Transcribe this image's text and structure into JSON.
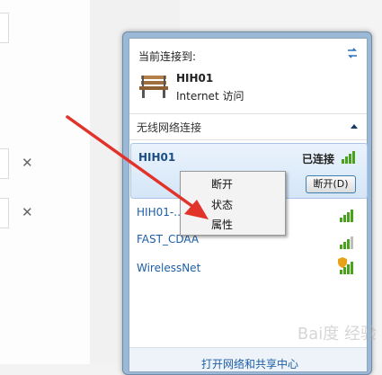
{
  "flyout": {
    "header_title": "当前连接到:",
    "current": {
      "name": "HIH01",
      "status": "Internet 访问"
    },
    "section_label": "无线网络连接",
    "selected": {
      "name": "HIH01",
      "status": "已连接",
      "button": "断开(D)"
    },
    "networks": [
      {
        "name": "HIH01-…",
        "signal": 4,
        "secured": false
      },
      {
        "name": "FAST_CDAA",
        "signal": 3,
        "secured": false
      },
      {
        "name": "WirelessNet",
        "signal": 4,
        "secured": true
      }
    ],
    "footer_link": "打开网络和共享中心"
  },
  "context_menu": {
    "items": [
      "断开",
      "状态",
      "属性"
    ]
  },
  "watermark": "Bai度 经验",
  "colors": {
    "accent_link": "#1d5fa6",
    "signal": "#4aa21c",
    "arrow": "#e2332b"
  }
}
